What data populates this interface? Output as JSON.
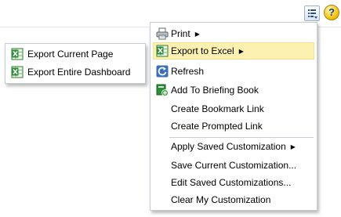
{
  "toolbar": {
    "page_options_icon": "page-options-icon",
    "help_label": "?"
  },
  "main_menu": {
    "items": [
      {
        "label": "Print",
        "icon": "printer-icon",
        "submenu": true
      },
      {
        "label": "Export to Excel",
        "icon": "excel-icon",
        "submenu": true,
        "highlighted": true
      },
      {
        "label": "Refresh",
        "icon": "refresh-icon"
      },
      {
        "label": "Add To Briefing Book",
        "icon": "briefing-book-add-icon"
      },
      {
        "label": "Create Bookmark Link"
      },
      {
        "label": "Create Prompted Link"
      },
      {
        "label": "Apply Saved Customization",
        "submenu": true
      },
      {
        "label": "Save Current Customization..."
      },
      {
        "label": "Edit Saved Customizations..."
      },
      {
        "label": "Clear My Customization"
      }
    ]
  },
  "export_submenu": {
    "items": [
      {
        "label": "Export Current Page",
        "icon": "excel-icon"
      },
      {
        "label": "Export Entire Dashboard",
        "icon": "excel-icon"
      }
    ]
  },
  "colors": {
    "highlight_bg": "#fcf1b1",
    "menu_border": "#c6ccd4",
    "excel_green": "#2e8b3a"
  },
  "submenu_arrow": "▶"
}
